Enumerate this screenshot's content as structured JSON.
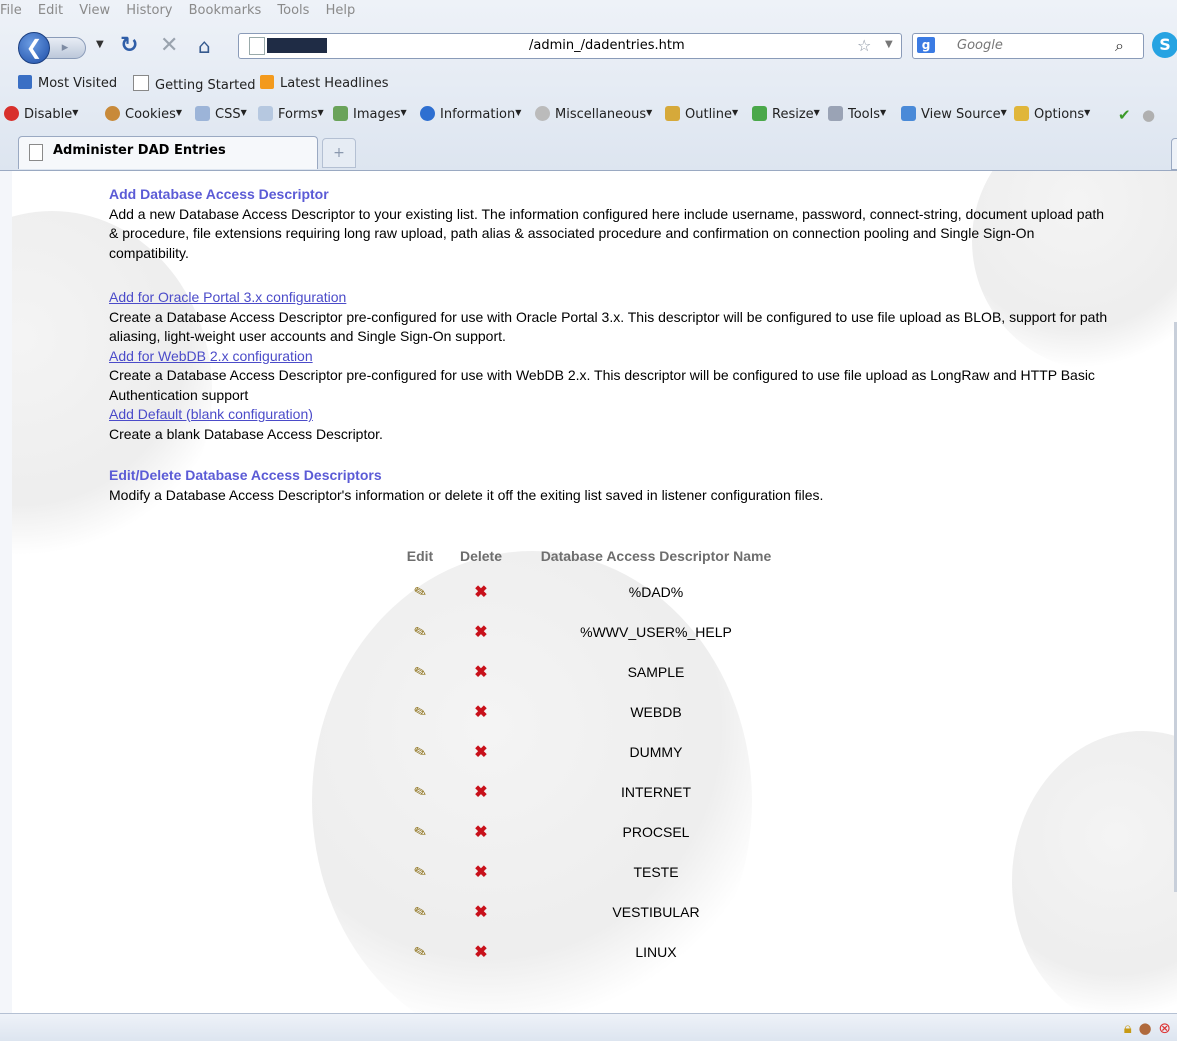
{
  "browser": {
    "menu": [
      "File",
      "Edit",
      "View",
      "History",
      "Bookmarks",
      "Tools",
      "Help"
    ],
    "url": "/admin_/dadentries.htm",
    "search_placeholder": "Google",
    "bookmarks": [
      "Most Visited",
      "Getting Started",
      "Latest Headlines"
    ],
    "dev_toolbar": [
      "Disable",
      "Cookies",
      "CSS",
      "Forms",
      "Images",
      "Information",
      "Miscellaneous",
      "Outline",
      "Resize",
      "Tools",
      "View Source",
      "Options"
    ],
    "tab_title": "Administer DAD Entries",
    "new_tab_symbol": "+"
  },
  "add_section": {
    "title": "Add Database Access Descriptor",
    "description": "Add a new Database Access Descriptor to your existing list. The information configured here include username, password, connect-string, document upload path & procedure, file extensions requiring long raw upload, path alias & associated procedure and confirmation on connection pooling and Single Sign-On compatibility.",
    "options": [
      {
        "link": "Add for Oracle Portal 3.x configuration",
        "description": "Create a Database Access Descriptor pre-configured for use with Oracle Portal 3.x. This descriptor will be configured to use file upload as BLOB, support for path aliasing, light-weight user accounts and Single Sign-On support."
      },
      {
        "link": "Add for WebDB 2.x configuration",
        "description": "Create a Database Access Descriptor pre-configured for use with WebDB 2.x. This descriptor will be configured to use file upload as LongRaw and HTTP Basic Authentication support"
      },
      {
        "link": "Add Default (blank configuration)",
        "description": "Create a blank Database Access Descriptor."
      }
    ]
  },
  "edit_section": {
    "title": "Edit/Delete Database Access Descriptors",
    "description": "Modify a Database Access Descriptor's information or delete it off the exiting list saved in listener configuration files."
  },
  "table": {
    "headers": [
      "Edit",
      "Delete",
      "Database Access Descriptor Name"
    ],
    "rows": [
      "%DAD%",
      "%WWV_USER%_HELP",
      "SAMPLE",
      "WEBDB",
      "DUMMY",
      "INTERNET",
      "PROCSEL",
      "TESTE",
      "VESTIBULAR",
      "LINUX"
    ]
  },
  "colors": {
    "section_title": "#5b5bd6",
    "link": "#4b4bc9",
    "footer_rule": "#0d1a5c",
    "delete_icon": "#c8101a"
  }
}
